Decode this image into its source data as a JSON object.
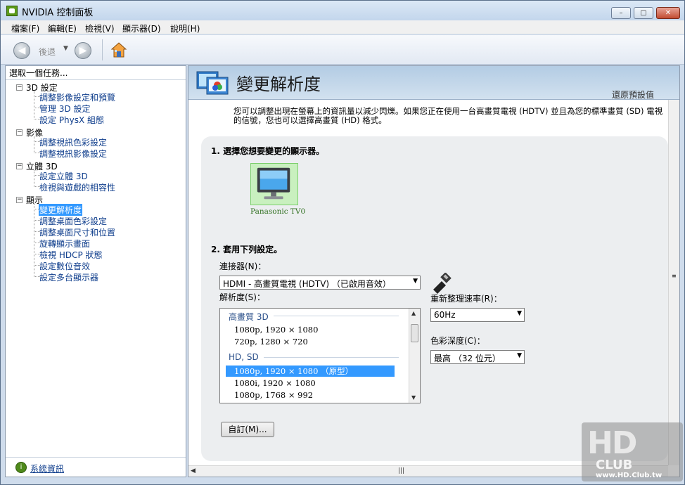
{
  "window": {
    "title": "NVIDIA 控制面板",
    "min_glyph": "–",
    "max_glyph": "▢",
    "close_glyph": "✕"
  },
  "menu": [
    "檔案(F)",
    "編輯(E)",
    "檢視(V)",
    "顯示器(D)",
    "說明(H)"
  ],
  "toolbar": {
    "back_label": "後退"
  },
  "left": {
    "header": "選取一個任務...",
    "tree": [
      {
        "label": "3D 設定",
        "children": [
          "調整影像設定和預覽",
          "管理 3D 設定",
          "設定 PhysX 組態"
        ]
      },
      {
        "label": "影像",
        "children": [
          "調整視訊色彩設定",
          "調整視訊影像設定"
        ]
      },
      {
        "label": "立體 3D",
        "children": [
          "設定立體 3D",
          "檢視與遊戲的相容性"
        ]
      },
      {
        "label": "顯示",
        "children": [
          "變更解析度",
          "調整桌面色彩設定",
          "調整桌面尺寸和位置",
          "旋轉顯示畫面",
          "檢視 HDCP 狀態",
          "設定數位音效",
          "設定多台顯示器"
        ]
      }
    ],
    "selected": "變更解析度",
    "footer_link": "系統資訊"
  },
  "right": {
    "title": "變更解析度",
    "restore": "還原預設值",
    "desc_line1": "您可以調整出現在螢幕上的資訊量以減少閃爍。如果您正在使用一台高畫質電視 (HDTV) 並且為您的標準畫質 (SD) 電視",
    "desc_line2": "的信號，您也可以選擇高畫質 (HD) 格式。",
    "step1": "1. 選擇您想要變更的顯示器。",
    "monitor_name": "Panasonic TV0",
    "step2": "2. 套用下列設定。",
    "connector_label": "連接器(N)：",
    "connector_value": "HDMI - 高畫質電視 (HDTV) （已啟用音效）",
    "resolution_label": "解析度(S)：",
    "resolution_groups": [
      {
        "name": "高畫質 3D",
        "items": [
          "1080p, 1920 × 1080",
          "720p, 1280 × 720"
        ]
      },
      {
        "name": "HD, SD",
        "items": [
          "1080p, 1920 × 1080 （原型）",
          "1080i, 1920 × 1080",
          "1080p, 1768 × 992"
        ]
      }
    ],
    "resolution_selected": "1080p, 1920 × 1080 （原型）",
    "refresh_label": "重新整理速率(R)：",
    "refresh_value": "60Hz",
    "depth_label": "色彩深度(C)：",
    "depth_value": "最高 （32 位元）",
    "custom_button": "自訂(M)..."
  },
  "watermark": {
    "big": "HD",
    "club": "CLUB",
    "url": "www.HD.Club.tw"
  }
}
